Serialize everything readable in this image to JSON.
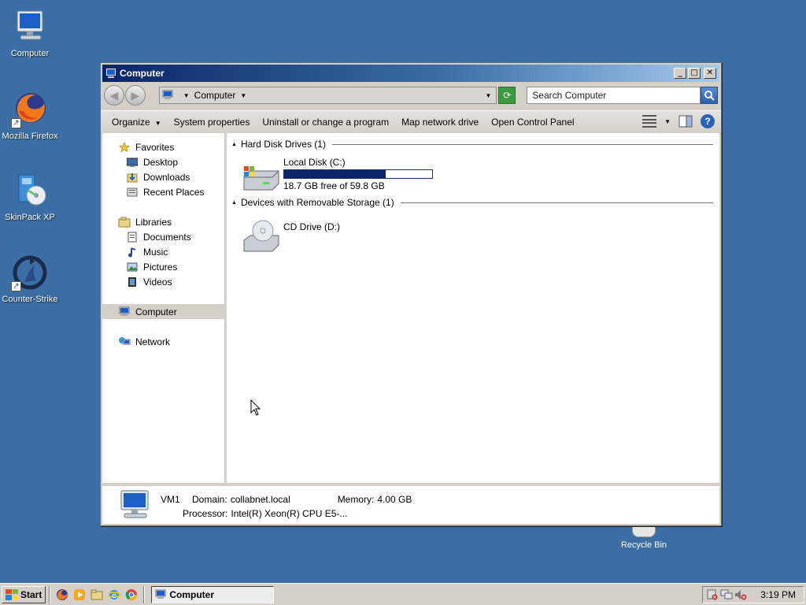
{
  "desktop": {
    "icons": [
      {
        "label": "Computer"
      },
      {
        "label": "Mozilla Firefox"
      },
      {
        "label": "SkinPack XP"
      },
      {
        "label": "Counter-Strike"
      }
    ],
    "recycle_bin": "Recycle Bin"
  },
  "window": {
    "title": "Computer",
    "controls": {
      "minimize": "_",
      "maximize": "□",
      "close": "✕"
    },
    "address": {
      "segment": "Computer"
    },
    "search_placeholder": "Search Computer",
    "commands": [
      {
        "label": "Organize"
      },
      {
        "label": "System properties"
      },
      {
        "label": "Uninstall or change a program"
      },
      {
        "label": "Map network drive"
      },
      {
        "label": "Open Control Panel"
      }
    ],
    "nav": {
      "favorites": "Favorites",
      "favorites_items": [
        "Desktop",
        "Downloads",
        "Recent Places"
      ],
      "libraries": "Libraries",
      "libraries_items": [
        "Documents",
        "Music",
        "Pictures",
        "Videos"
      ],
      "computer": "Computer",
      "network": "Network"
    },
    "groups": [
      {
        "label": "Hard Disk Drives (1)"
      },
      {
        "label": "Devices with Removable Storage (1)"
      }
    ],
    "drives": [
      {
        "name": "Local Disk (C:)",
        "free_text": "18.7 GB free of 59.8 GB",
        "used_fraction": 0.687
      },
      {
        "name": "CD Drive (D:)"
      }
    ],
    "details": {
      "name": "VM1",
      "domain_label": "Domain:",
      "domain_value": "collabnet.local",
      "memory_label": "Memory:",
      "memory_value": "4.00 GB",
      "processor_label": "Processor:",
      "processor_value": "Intel(R) Xeon(R) CPU E5-..."
    }
  },
  "taskbar": {
    "start_label": "Start",
    "task_label": "Computer",
    "clock": "3:19 PM"
  },
  "colors": {
    "desktop": "#3a6ea5",
    "titlebar_start": "#0a246a",
    "progress": "#0a246a"
  }
}
